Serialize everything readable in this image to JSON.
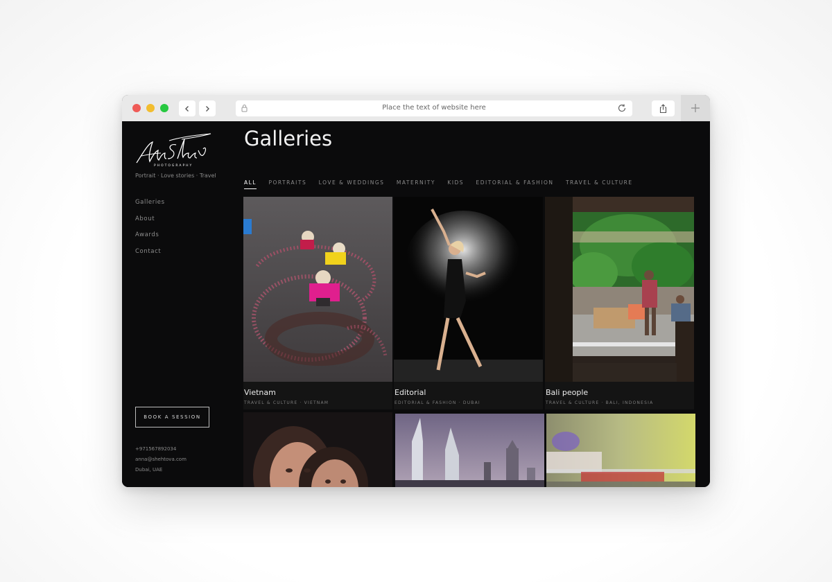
{
  "browser": {
    "address_text": "Place the text of website here"
  },
  "brand": {
    "logo_text": "Anna Shehtova",
    "logo_subtitle": "PHOTOGRAPHY",
    "tagline": "Portrait · Love stories · Travel"
  },
  "sidebar": {
    "nav": [
      {
        "label": "Galleries"
      },
      {
        "label": "About"
      },
      {
        "label": "Awards"
      },
      {
        "label": "Contact"
      }
    ],
    "book_label": "BOOK A SESSION",
    "contact": {
      "phone": "+971567892034",
      "email": "anna@shehtova.com",
      "location": "Dubai, UAE"
    }
  },
  "main": {
    "title": "Galleries",
    "filters": [
      {
        "label": "ALL",
        "active": true
      },
      {
        "label": "PORTRAITS"
      },
      {
        "label": "LOVE & WEDDINGS"
      },
      {
        "label": "MATERNITY"
      },
      {
        "label": "KIDS"
      },
      {
        "label": "EDITORIAL & FASHION"
      },
      {
        "label": "TRAVEL & CULTURE"
      }
    ],
    "galleries": [
      {
        "title": "Vietnam",
        "meta": "TRAVEL & CULTURE · VIETNAM"
      },
      {
        "title": "Editorial",
        "meta": "EDITORIAL & FASHION · DUBAI"
      },
      {
        "title": "Bali people",
        "meta": "TRAVEL & CULTURE · BALI, INDONESIA"
      }
    ]
  },
  "colors": {
    "page_bg": "#0b0b0c",
    "text_primary": "#f2f2f2",
    "text_muted": "#8a8a8a"
  }
}
